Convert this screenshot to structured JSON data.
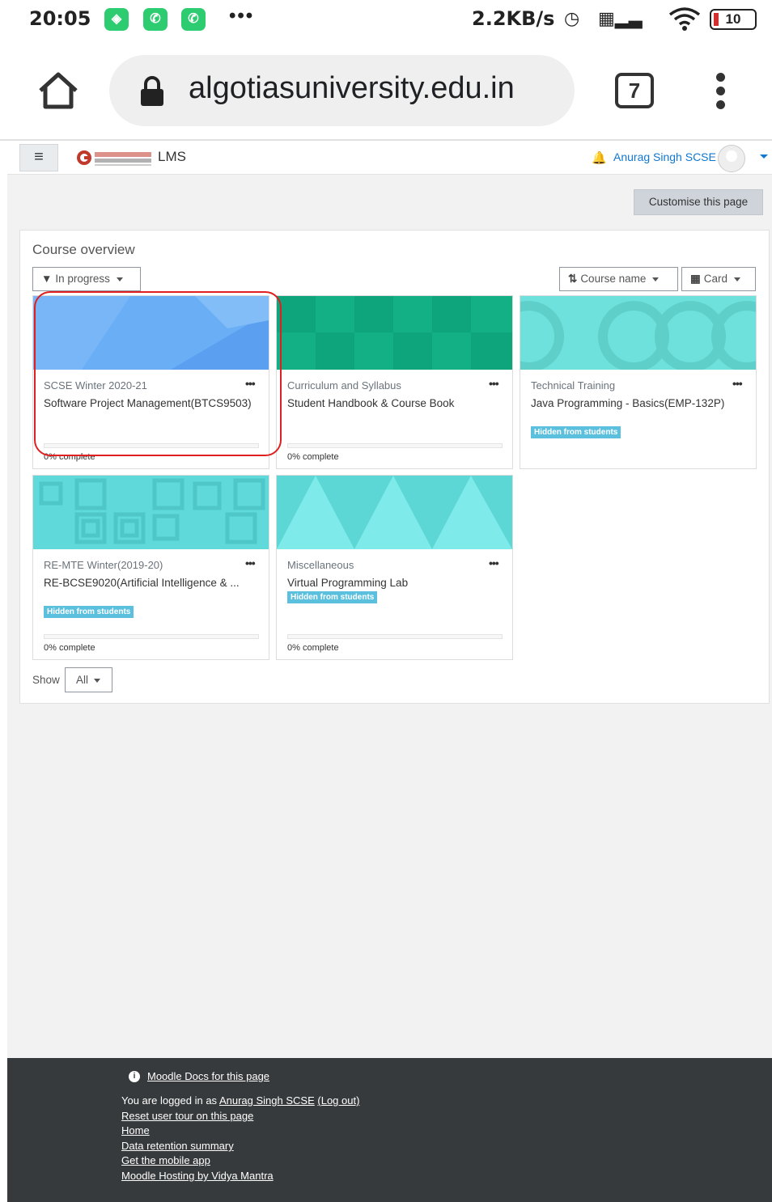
{
  "status_bar": {
    "time": "20:05",
    "more": "•••",
    "net_speed": "2.2KB/s",
    "battery": "10"
  },
  "browser": {
    "url": "algotiasuniversity.edu.in",
    "tab_count": "7"
  },
  "navbar": {
    "brand_text": "LMS",
    "user_name": "Anurag Singh SCSE"
  },
  "customise_label": "Customise this page",
  "overview": {
    "title": "Course overview",
    "filter_label": "In progress",
    "sort_label": "Course name",
    "view_label": "Card",
    "show_label": "Show",
    "show_value": "All"
  },
  "courses": [
    {
      "category": "SCSE Winter 2020-21",
      "name": "Software Project Management(BTCS9503)",
      "hidden_badge": "",
      "progress_text": "0% complete",
      "progress": 0,
      "image_color": "#6aaef5"
    },
    {
      "category": "Curriculum and Syllabus",
      "name": "Student Handbook & Course Book",
      "hidden_badge": "",
      "progress_text": "0% complete",
      "progress": 0,
      "image_color": "#14b085"
    },
    {
      "category": "Technical Training",
      "name": "Java Programming - Basics(EMP-132P)",
      "hidden_badge": "Hidden from students",
      "progress_text": "",
      "progress": 0,
      "image_color": "#6ee1dc"
    },
    {
      "category": "RE-MTE Winter(2019-20)",
      "name": "RE-BCSE9020(Artificial Intelligence & ...",
      "hidden_badge": "Hidden from students",
      "progress_text": "0% complete",
      "progress": 0,
      "image_color": "#5fd9da"
    },
    {
      "category": "Miscellaneous",
      "name": "Virtual Programming Lab",
      "hidden_badge": "Hidden from students",
      "progress_text": "0% complete",
      "progress": 0,
      "image_color": "#6fe3e3"
    }
  ],
  "footer": {
    "docs_link": "Moodle Docs for this page",
    "logged_in_prefix": "You are logged in as ",
    "logged_in_user": "Anurag Singh SCSE",
    "logout_link": "(Log out)",
    "links": [
      "Reset user tour on this page",
      "Home",
      "Data retention summary",
      "Get the mobile app",
      "Moodle Hosting by Vidya Mantra"
    ]
  },
  "colors": {
    "accent": "#1177d1",
    "badge": "#5bc0de",
    "footer_bg": "#373a3c",
    "highlight": "#e02020"
  }
}
